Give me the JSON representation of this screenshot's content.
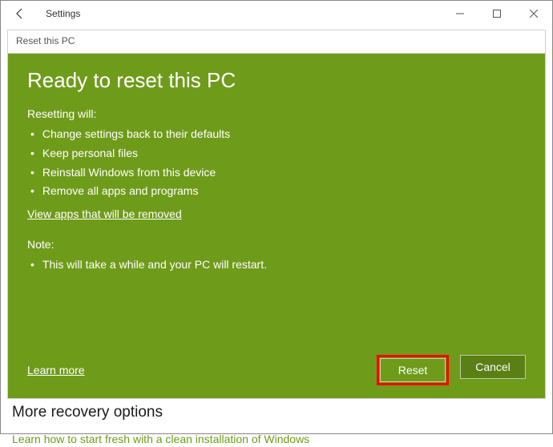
{
  "titlebar": {
    "app_title": "Settings"
  },
  "dialog": {
    "header": "Reset this PC",
    "title": "Ready to reset this PC",
    "sub_heading": "Resetting will:",
    "bullets": [
      "Change settings back to their defaults",
      "Keep personal files",
      "Reinstall Windows from this device",
      "Remove all apps and programs"
    ],
    "view_apps_link": "View apps that will be removed",
    "note_heading": "Note:",
    "note_bullets": [
      "This will take a while and your PC will restart."
    ],
    "learn_more": "Learn more",
    "reset_label": "Reset",
    "cancel_label": "Cancel"
  },
  "below": {
    "more_heading": "More recovery options",
    "fresh_start_link": "Learn how to start fresh with a clean installation of Windows"
  }
}
